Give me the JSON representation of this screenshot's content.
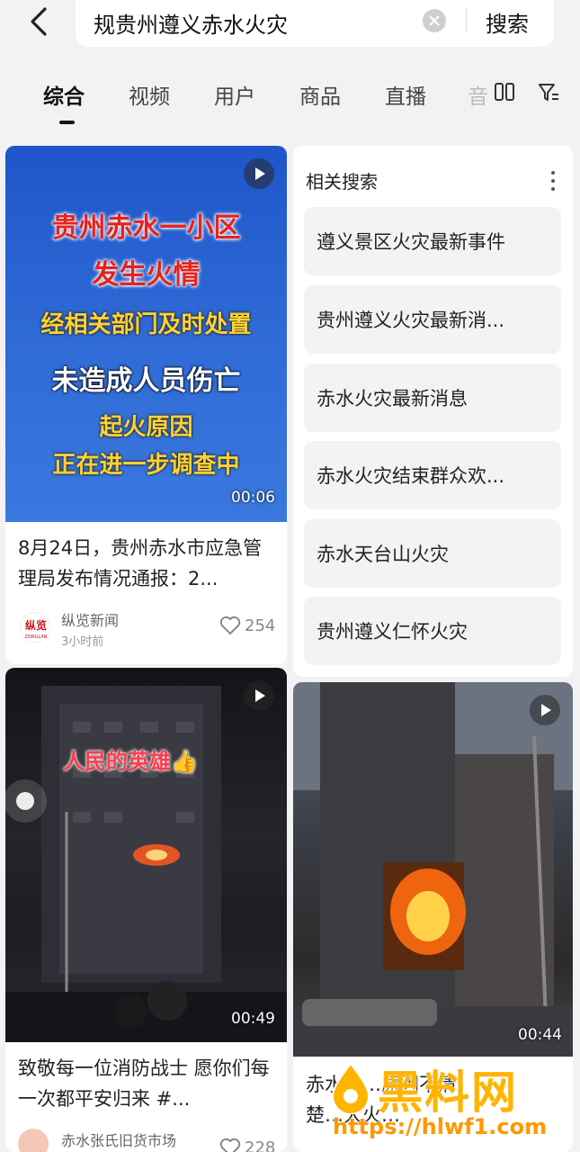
{
  "search": {
    "query": "规贵州遵义赤水火灾",
    "button_label": "搜索"
  },
  "tabs": [
    {
      "label": "综合",
      "active": true
    },
    {
      "label": "视频",
      "active": false
    },
    {
      "label": "用户",
      "active": false
    },
    {
      "label": "商品",
      "active": false
    },
    {
      "label": "直播",
      "active": false
    },
    {
      "label": "音",
      "active": false
    }
  ],
  "card1": {
    "thumb_lines": [
      "贵州赤水一小区",
      "发生火情",
      "经相关部门及时处置",
      "未造成人员伤亡",
      "起火原因",
      "正在进一步调查中"
    ],
    "duration": "00:06",
    "title": "8月24日，贵州赤水市应急管理局发布情况通报：2...",
    "author": "纵览新闻",
    "author_logo_text": "纵览",
    "author_logo_sub": "ZONGLAN",
    "time": "3小时前",
    "likes": "254"
  },
  "related": {
    "title": "相关搜索",
    "items": [
      "遵义景区火灾最新事件",
      "贵州遵义火灾最新消...",
      "赤水火灾最新消息",
      "赤水火灾结束群众欢...",
      "赤水天台山火灾",
      "贵州遵义仁怀火灾"
    ]
  },
  "card2": {
    "overlay_text": "人民的英雄👍",
    "duration": "00:49",
    "title": "致敬每一位消防战士 愿你们每一次都平安归来 #...",
    "author": "赤水张氏旧货市场",
    "likes": "228"
  },
  "card3": {
    "duration": "00:44",
    "title_visible": "赤水这…原因不清楚…大火…"
  },
  "watermark": {
    "brand": "黑料网",
    "url": "https://hlwf1.com"
  },
  "colors": {
    "accent_red": "#e3231e",
    "thumb_blue": "#2f6ad6",
    "watermark_orange": "#ffb400"
  }
}
